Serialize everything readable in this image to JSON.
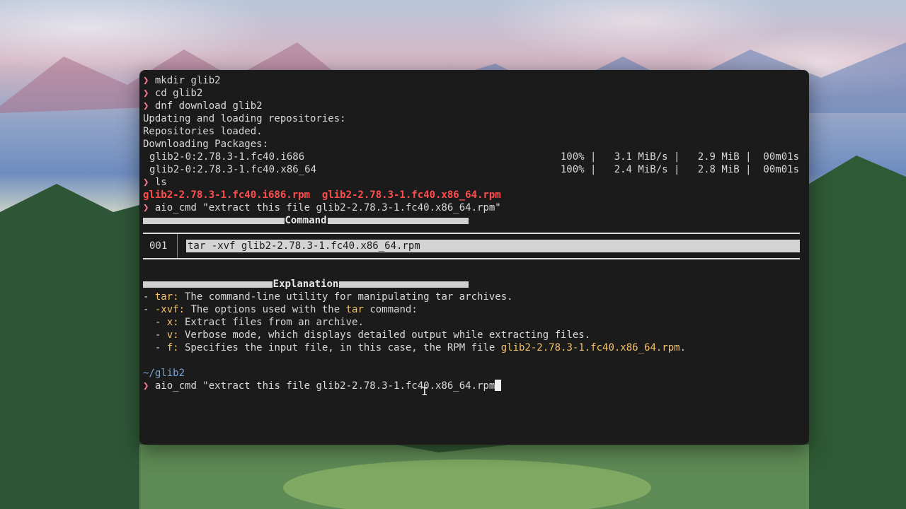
{
  "terminal": {
    "prompt_symbol": "❯",
    "commands": [
      "mkdir glib2",
      "cd glib2",
      "dnf download glib2"
    ],
    "dnf_output": [
      "Updating and loading repositories:",
      "Repositories loaded.",
      "Downloading Packages:"
    ],
    "downloads": [
      {
        "name": "glib2-0:2.78.3-1.fc40.i686",
        "stats": "100% |   3.1 MiB/s |   2.9 MiB |  00m01s"
      },
      {
        "name": "glib2-0:2.78.3-1.fc40.x86_64",
        "stats": "100% |   2.4 MiB/s |   2.8 MiB |  00m01s"
      }
    ],
    "ls_command": "ls",
    "ls_output": "glib2-2.78.3-1.fc40.i686.rpm  glib2-2.78.3-1.fc40.x86_64.rpm",
    "aio_command": "aio_cmd \"extract this file glib2-2.78.3-1.fc40.x86_64.rpm\"",
    "command_panel_title": "Command",
    "command_number": "001",
    "command_text": "tar -xvf glib2-2.78.3-1.fc40.x86_64.rpm",
    "explanation_panel_title": "Explanation",
    "explanation": {
      "l1_prefix": "- ",
      "l1_key": "tar:",
      "l1_text": " The command-line utility for manipulating tar archives.",
      "l2_prefix": "- ",
      "l2_key": "-xvf:",
      "l2_text_a": " The options used with the ",
      "l2_tar": "tar",
      "l2_text_b": " command:",
      "l3_prefix": "  - ",
      "l3_key": "x:",
      "l3_text": " Extract files from an archive.",
      "l4_prefix": "  - ",
      "l4_key": "v:",
      "l4_text": " Verbose mode, which displays detailed output while extracting files.",
      "l5_prefix": "  - ",
      "l5_key": "f:",
      "l5_text": " Specifies the input file, in this case, the RPM file ",
      "l5_file": "glib2-2.78.3-1.fc40.x86_64.rpm",
      "l5_end": "."
    },
    "cwd": "~/glib2",
    "current_input": "aio_cmd \"extract this file glib2-2.78.3-1.fc40.x86_64.rpm"
  },
  "colors": {
    "prompt": "#ff7a93",
    "error_red": "#ff4d4d",
    "highlight_yellow": "#f3c26b",
    "path_blue": "#7aa6d6",
    "terminal_bg": "#1b1b1b"
  }
}
